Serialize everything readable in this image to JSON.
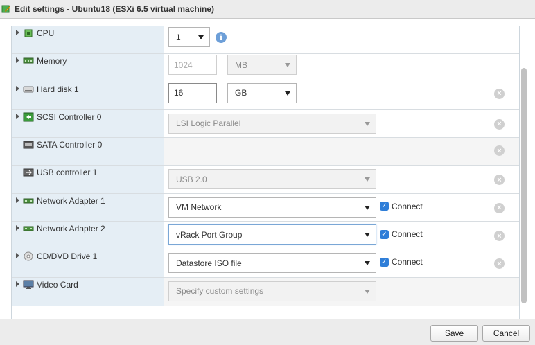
{
  "window": {
    "title": "Edit settings - Ubuntu18 (ESXi 6.5 virtual machine)"
  },
  "devices": [
    {
      "label": "CPU",
      "icon": "cpu-icon",
      "expandable": true
    },
    {
      "label": "Memory",
      "icon": "memory-icon",
      "expandable": true
    },
    {
      "label": "Hard disk 1",
      "icon": "hard-disk-icon",
      "expandable": true
    },
    {
      "label": "SCSI Controller 0",
      "icon": "scsi-controller-icon",
      "expandable": true
    },
    {
      "label": "SATA Controller 0",
      "icon": "sata-controller-icon",
      "expandable": false
    },
    {
      "label": "USB controller 1",
      "icon": "usb-icon",
      "expandable": false
    },
    {
      "label": "Network Adapter 1",
      "icon": "network-adapter-icon",
      "expandable": true
    },
    {
      "label": "Network Adapter 2",
      "icon": "network-adapter-icon",
      "expandable": true
    },
    {
      "label": "CD/DVD Drive 1",
      "icon": "cd-dvd-icon",
      "expandable": true
    },
    {
      "label": "Video Card",
      "icon": "monitor-icon",
      "expandable": true
    }
  ],
  "cpu": {
    "value": "1",
    "info_glyph": "i"
  },
  "memory": {
    "value": "1024",
    "unit": "MB"
  },
  "hard_disk": {
    "value": "16",
    "unit": "GB"
  },
  "scsi": {
    "value": "LSI Logic Parallel"
  },
  "usb": {
    "value": "USB 2.0"
  },
  "net1": {
    "value": "VM Network",
    "connect_label": "Connect",
    "connected": true
  },
  "net2": {
    "value": "vRack Port Group",
    "connect_label": "Connect",
    "connected": true
  },
  "cdrom": {
    "value": "Datastore ISO file",
    "connect_label": "Connect",
    "connected": true
  },
  "video": {
    "value": "Specify custom settings"
  },
  "glyphs": {
    "check": "✓",
    "remove": "×"
  },
  "footer": {
    "save_label": "Save",
    "cancel_label": "Cancel"
  },
  "colors": {
    "label_column": "#e5eef5",
    "accent": "#2f7ed8",
    "info": "#6d9fd8"
  }
}
